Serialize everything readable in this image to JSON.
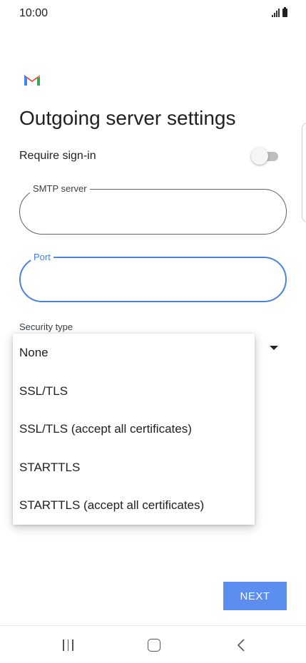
{
  "status_bar": {
    "time": "10:00",
    "icons": [
      "signal-icon",
      "battery-icon"
    ]
  },
  "app": {
    "logo": "gmail-logo",
    "colors": {
      "blue": "#4285f4",
      "red": "#ea4335",
      "yellow": "#fbbc04",
      "green": "#34a853"
    }
  },
  "page": {
    "title": "Outgoing server settings"
  },
  "require_signin": {
    "label": "Require sign-in",
    "enabled": false
  },
  "smtp_server": {
    "label": "SMTP server",
    "value": ""
  },
  "port": {
    "label": "Port",
    "value": "",
    "focused": true
  },
  "security_type": {
    "label": "Security type",
    "options": [
      "None",
      "SSL/TLS",
      "SSL/TLS (accept all certificates)",
      "STARTTLS",
      "STARTTLS (accept all certificates)"
    ]
  },
  "actions": {
    "next_label": "NEXT"
  },
  "nav_bar": {
    "icons": [
      "recents-icon",
      "home-icon",
      "back-icon"
    ]
  },
  "colors": {
    "accent": "#4a80e0",
    "button": "#5b8ef0"
  }
}
